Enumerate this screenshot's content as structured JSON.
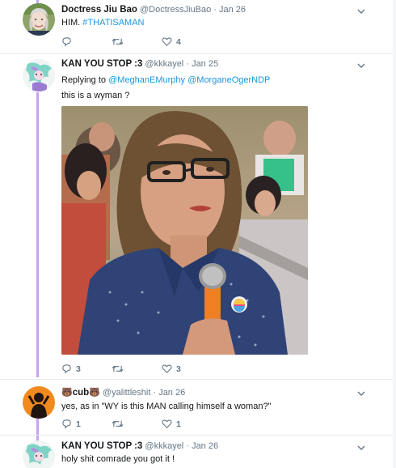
{
  "tweets": [
    {
      "name": "Doctress Jiu Bao",
      "handle": "@DoctressJiuBao",
      "time": "Jan 26",
      "text_plain": "HIM.",
      "text_hashtag": "#THATISAMAN",
      "replies": "",
      "retweets": "",
      "likes": "4"
    },
    {
      "name": "KAN YOU STOP :3",
      "handle": "@kkkayel",
      "time": "Jan 25",
      "replying_prefix": "Replying to",
      "replying_to_1": "@MeghanEMurphy",
      "replying_to_2": "@MorganeOgerNDP",
      "text": "this is a wyman ?",
      "replies": "3",
      "retweets": "",
      "likes": "3"
    },
    {
      "name_emoji_left": "🐻",
      "name": "cub",
      "name_emoji_right": "🐻",
      "handle": "@yalittleshit",
      "time": "Jan 26",
      "text": "yes, as in \"WY is this MAN calling himself a woman?\"",
      "replies": "1",
      "retweets": "",
      "likes": "1"
    },
    {
      "name": "KAN YOU STOP :3",
      "handle": "@kkkayel",
      "time": "Jan 26",
      "text": "holy shit comrade you got it !"
    }
  ],
  "colors": {
    "link": "#1b95e0",
    "muted": "#657786",
    "thread": "#c7a2ee",
    "divider": "#e6ecf0"
  },
  "icons": [
    "reply-icon",
    "retweet-icon",
    "like-icon",
    "chevron-down-icon"
  ]
}
